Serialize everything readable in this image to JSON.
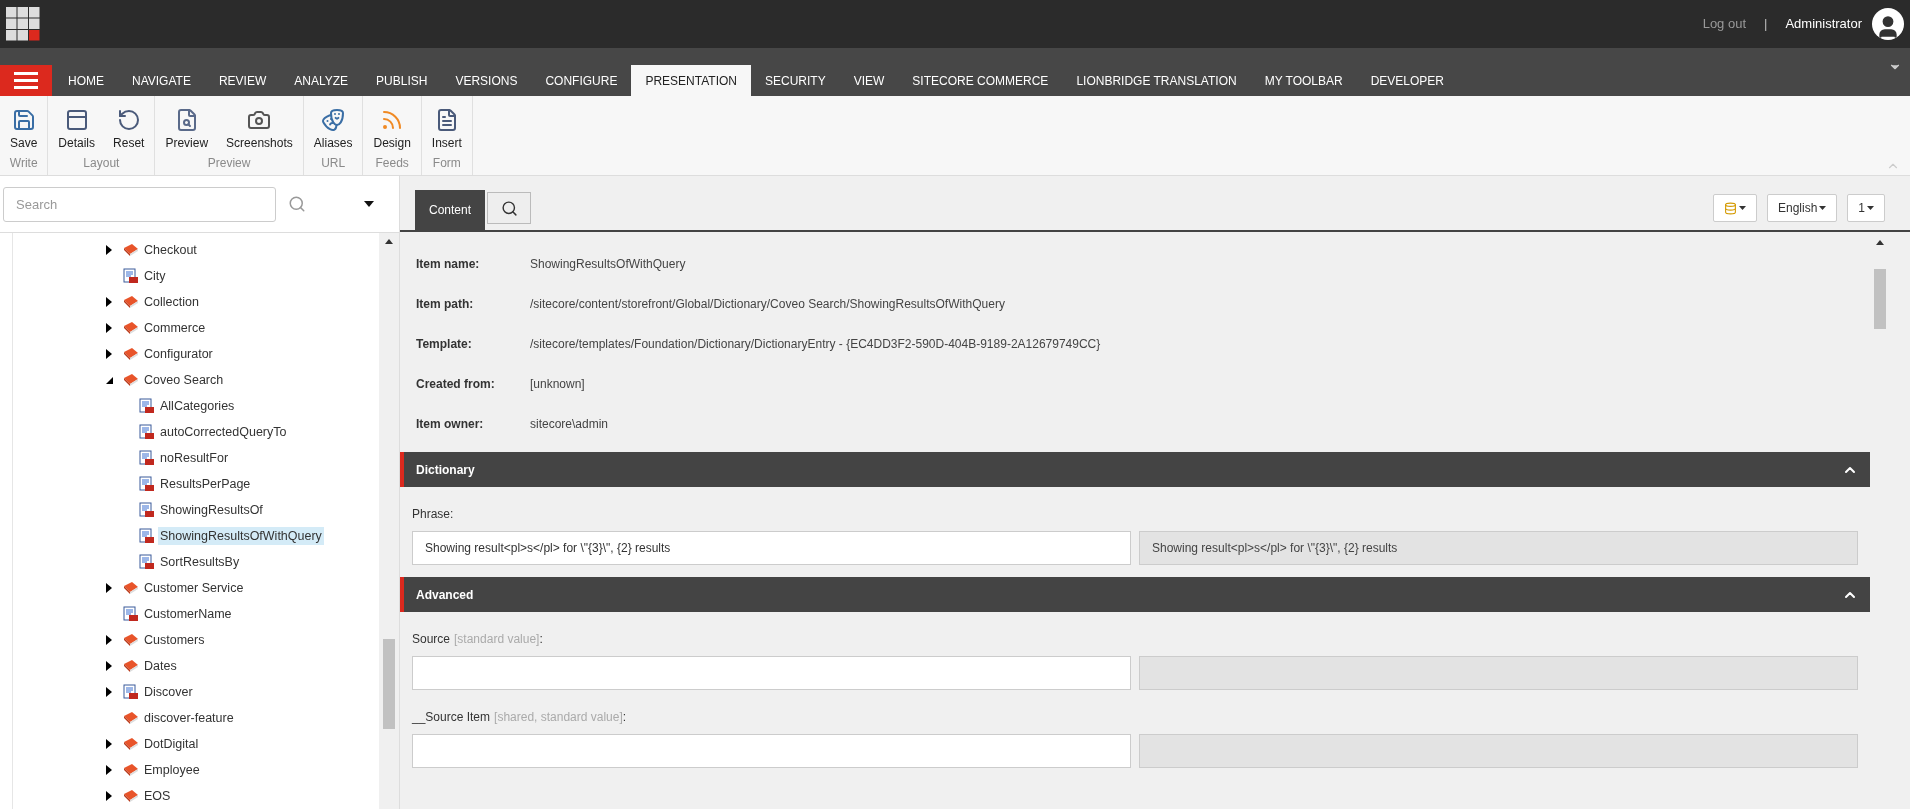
{
  "header": {
    "logout": "Log out",
    "separator": "|",
    "user": "Administrator"
  },
  "tabs": [
    {
      "label": "HOME",
      "selected": false
    },
    {
      "label": "NAVIGATE",
      "selected": false
    },
    {
      "label": "REVIEW",
      "selected": false
    },
    {
      "label": "ANALYZE",
      "selected": false
    },
    {
      "label": "PUBLISH",
      "selected": false
    },
    {
      "label": "VERSIONS",
      "selected": false
    },
    {
      "label": "CONFIGURE",
      "selected": false
    },
    {
      "label": "PRESENTATION",
      "selected": true
    },
    {
      "label": "SECURITY",
      "selected": false
    },
    {
      "label": "VIEW",
      "selected": false
    },
    {
      "label": "SITECORE COMMERCE",
      "selected": false
    },
    {
      "label": "LIONBRIDGE TRANSLATION",
      "selected": false
    },
    {
      "label": "MY TOOLBAR",
      "selected": false
    },
    {
      "label": "DEVELOPER",
      "selected": false
    }
  ],
  "ribbon": [
    {
      "group": "Write",
      "buttons": [
        {
          "label": "Save",
          "kind": "save"
        }
      ]
    },
    {
      "group": "Layout",
      "buttons": [
        {
          "label": "Details",
          "kind": "details"
        },
        {
          "label": "Reset",
          "kind": "reset"
        }
      ]
    },
    {
      "group": "Preview",
      "buttons": [
        {
          "label": "Preview",
          "kind": "preview"
        },
        {
          "label": "Screenshots",
          "kind": "camera"
        }
      ]
    },
    {
      "group": "URL",
      "buttons": [
        {
          "label": "Aliases",
          "kind": "masks"
        }
      ]
    },
    {
      "group": "Feeds",
      "buttons": [
        {
          "label": "Design",
          "kind": "rss"
        }
      ]
    },
    {
      "group": "Form",
      "buttons": [
        {
          "label": "Insert",
          "kind": "insert"
        }
      ]
    }
  ],
  "search": {
    "placeholder": "Search"
  },
  "tree": [
    {
      "label": "Checkout",
      "kind": "folder",
      "expandable": true,
      "expanded": false,
      "selected": false
    },
    {
      "label": "City",
      "kind": "entry",
      "expandable": false,
      "expanded": false,
      "selected": false
    },
    {
      "label": "Collection",
      "kind": "folder",
      "expandable": true,
      "expanded": false,
      "selected": false
    },
    {
      "label": "Commerce",
      "kind": "folder",
      "expandable": true,
      "expanded": false,
      "selected": false
    },
    {
      "label": "Configurator",
      "kind": "folder",
      "expandable": true,
      "expanded": false,
      "selected": false
    },
    {
      "label": "Coveo Search",
      "kind": "folder",
      "expandable": true,
      "expanded": true,
      "selected": false,
      "children": [
        {
          "label": "AllCategories",
          "kind": "entry",
          "expandable": false,
          "expanded": false,
          "selected": false
        },
        {
          "label": "autoCorrectedQueryTo",
          "kind": "entry",
          "expandable": false,
          "expanded": false,
          "selected": false
        },
        {
          "label": "noResultFor",
          "kind": "entry",
          "expandable": false,
          "expanded": false,
          "selected": false
        },
        {
          "label": "ResultsPerPage",
          "kind": "entry",
          "expandable": false,
          "expanded": false,
          "selected": false
        },
        {
          "label": "ShowingResultsOf",
          "kind": "entry",
          "expandable": false,
          "expanded": false,
          "selected": false
        },
        {
          "label": "ShowingResultsOfWithQuery",
          "kind": "entry",
          "expandable": false,
          "expanded": false,
          "selected": true
        },
        {
          "label": "SortResultsBy",
          "kind": "entry",
          "expandable": false,
          "expanded": false,
          "selected": false
        }
      ]
    },
    {
      "label": "Customer Service",
      "kind": "folder",
      "expandable": true,
      "expanded": false,
      "selected": false
    },
    {
      "label": "CustomerName",
      "kind": "entry",
      "expandable": false,
      "expanded": false,
      "selected": false
    },
    {
      "label": "Customers",
      "kind": "folder",
      "expandable": true,
      "expanded": false,
      "selected": false
    },
    {
      "label": "Dates",
      "kind": "folder",
      "expandable": true,
      "expanded": false,
      "selected": false
    },
    {
      "label": "Discover",
      "kind": "entry",
      "expandable": true,
      "expanded": false,
      "selected": false
    },
    {
      "label": "discover-feature",
      "kind": "folder",
      "expandable": false,
      "expanded": false,
      "selected": false
    },
    {
      "label": "DotDigital",
      "kind": "folder",
      "expandable": true,
      "expanded": false,
      "selected": false
    },
    {
      "label": "Employee",
      "kind": "folder",
      "expandable": true,
      "expanded": false,
      "selected": false
    },
    {
      "label": "EOS",
      "kind": "folder",
      "expandable": true,
      "expanded": false,
      "selected": false
    }
  ],
  "editor_tabs": [
    {
      "label": "Content",
      "kind": "text",
      "selected": true
    },
    {
      "kind": "search",
      "selected": false
    }
  ],
  "editor_buttons": [
    {
      "kind": "database"
    },
    {
      "kind": "text",
      "label": "English"
    },
    {
      "kind": "text",
      "label": "1"
    }
  ],
  "info": [
    {
      "label": "Item name:",
      "value": "ShowingResultsOfWithQuery"
    },
    {
      "label": "Item path:",
      "value": "/sitecore/content/storefront/Global/Dictionary/Coveo Search/ShowingResultsOfWithQuery"
    },
    {
      "label": "Template:",
      "value": "/sitecore/templates/Foundation/Dictionary/DictionaryEntry - {EC4DD3F2-590D-404B-9189-2A12679749CC}"
    },
    {
      "label": "Created from:",
      "value": "[unknown]"
    },
    {
      "label": "Item owner:",
      "value": "sitecore\\admin"
    }
  ],
  "sections": [
    {
      "title": "Dictionary",
      "expanded": true,
      "fields": [
        {
          "label": "Phrase",
          "tail": ":",
          "value": "Showing result<pl>s</pl> for \\\"{3}\\\", {2} results",
          "original": "Showing result<pl>s</pl> for \\\"{3}\\\", {2} results"
        }
      ]
    },
    {
      "title": "Advanced",
      "expanded": true,
      "fields": [
        {
          "label": "Source",
          "note": "[standard value]",
          "tail": ":"
        },
        {
          "label": "__Source Item",
          "note": "[shared, standard value]",
          "tail": ":"
        }
      ]
    }
  ]
}
